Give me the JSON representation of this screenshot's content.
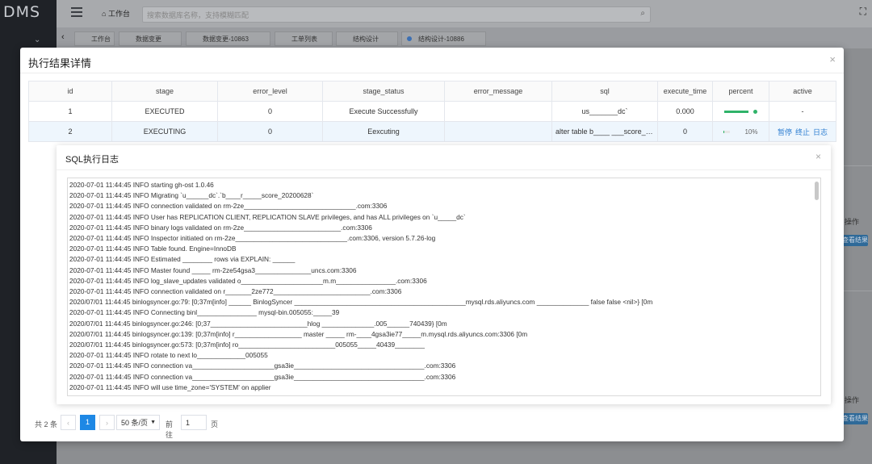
{
  "app": {
    "logo": "DMS",
    "chevron": "⌄",
    "home_label": "工作台",
    "search_placeholder": "搜索数据库名称，支持模糊匹配",
    "tabs": [
      "工作台",
      "数据变更",
      "数据变更-10863",
      "工单列表",
      "结构设计",
      "结构设计-10886"
    ],
    "right_labels": [
      "操作",
      "查看结果",
      "操作",
      "查看结果"
    ]
  },
  "modal": {
    "title": "执行结果详情",
    "close": "×",
    "columns": [
      "id",
      "stage",
      "error_level",
      "stage_status",
      "error_message",
      "sql",
      "execute_time",
      "percent",
      "active"
    ],
    "rows": [
      {
        "id": "1",
        "stage": "EXECUTED",
        "error_level": "0",
        "stage_status": "Execute Successfully",
        "error_message": "",
        "sql": "us_______dc`",
        "execute_time": "0.000",
        "percent": 1.0,
        "percent_text": "",
        "active": "-"
      },
      {
        "id": "2",
        "stage": "EXECUTING",
        "error_level": "0",
        "stage_status": "Eexcuting",
        "error_message": "",
        "sql": "alter table b____ ___score_2...",
        "execute_time": "0",
        "percent": 0.1,
        "percent_text": "10%",
        "actions": [
          "暂停",
          "终止",
          "日志"
        ]
      }
    ]
  },
  "log_dialog": {
    "title": "SQL执行日志",
    "close": "×",
    "lines": [
      "2020-07-01 11:44:45 INFO starting gh-ost 1.0.46",
      "2020-07-01 11:44:45 INFO Migrating `u______dc`.`b____r_____score_20200628`",
      "2020-07-01 11:44:45 INFO connection validated on rm-2ze______________________________.com:3306",
      "2020-07-01 11:44:45 INFO User has REPLICATION CLIENT, REPLICATION SLAVE privileges, and has ALL privileges on `u_____dc`",
      "2020-07-01 11:44:45 INFO binary logs validated on rm-2ze__________________________.com:3306",
      "2020-07-01 11:44:45 INFO Inspector initiated on rm-2ze______________________________.com:3306, version 5.7.26-log",
      "2020-07-01 11:44:45 INFO Table found. Engine=InnoDB",
      "2020-07-01 11:44:45 INFO Estimated ________ rows via EXPLAIN: ______",
      "2020-07-01 11:44:45 INFO Master found _____ rm-2ze54gsa3_______________uncs.com:3306",
      "2020-07-01 11:44:45 INFO log_slave_updates validated o______________________m.m________________.com:3306",
      "2020-07-01 11:44:45 INFO connection validated on r_______2ze772__________________________.com:3306",
      "2020/07/01 11:44:45 binlogsyncer.go:79:   [0;37m[info] ______ BinlogSyncer ______________________________________________mysql.rds.aliyuncs.com ______________ false false <nil>} [0m",
      "2020-07-01 11:44:45 INFO Connecting binl________________ mysql-bin.005055:_____39",
      "2020/07/01 11:44:45 binlogsyncer.go:246:   [0;37__________________________hlog ______________.005______740439} [0m",
      "2020/07/01 11:44:45 binlogsyncer.go:139:   [0;37m[info] r__________________ master _____ rm-____4gsa3ie77_____m.mysql.rds.aliyuncs.com:3306 [0m",
      "2020/07/01 11:44:45 binlogsyncer.go:573:   [0;37m[info] ro__________________________005055_____40439________",
      "2020-07-01 11:44:45 INFO rotate to next lo_____________005055",
      "2020-07-01 11:44:45 INFO connection va______________________gsa3ie___________________________________.com:3306",
      "2020-07-01 11:44:45 INFO connection va______________________gsa3ie___________________________________.com:3306",
      "2020-07-01 11:44:45 INFO will use time_zone='SYSTEM' on applier"
    ]
  },
  "pagination": {
    "total": "共 2 条",
    "prev": "‹",
    "current": "1",
    "next": "›",
    "page_size": "50 条/页",
    "goto_label": "前往",
    "goto_value": "1",
    "page_label": "页"
  },
  "colors": {
    "accent": "#1e88e5",
    "success": "#2fb369",
    "link": "#2d7ed1"
  }
}
